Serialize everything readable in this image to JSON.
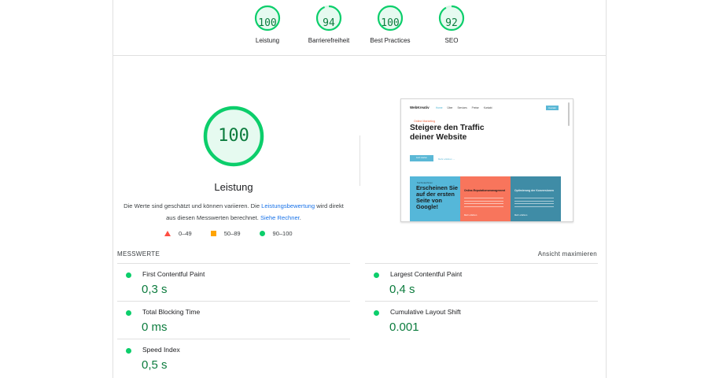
{
  "category_scores": [
    {
      "score": "100",
      "label": "Leistung"
    },
    {
      "score": "94",
      "label": "Barrierefreiheit"
    },
    {
      "score": "100",
      "label": "Best Practices"
    },
    {
      "score": "92",
      "label": "SEO"
    }
  ],
  "performance": {
    "score": "100",
    "title": "Leistung",
    "desc_part1": "Die Werte sind geschätzt und können variieren. Die ",
    "desc_link1": "Leistungsbewertung",
    "desc_part2": " wird direkt aus diesen Messwerten berechnet. ",
    "desc_link2": "Siehe Rechner",
    "desc_part3": "."
  },
  "legend": [
    {
      "shape": "triangle",
      "range": "0–49",
      "color": "#ff4e42"
    },
    {
      "shape": "square",
      "range": "50–89",
      "color": "#ffa400"
    },
    {
      "shape": "circle",
      "range": "90–100",
      "color": "#0cce6b"
    }
  ],
  "screenshot": {
    "brand": "WebKreativ",
    "nav": [
      "Home",
      "Über",
      "Services",
      "Preise",
      "Kontakt"
    ],
    "nav_button": "Kontakt",
    "kicker": "Online Marketing",
    "headline": "Steigere den Traffic deiner Website",
    "cta": "Jetzt starten",
    "link": "Mehr erfahren →",
    "card1_kicker": "Suchmaschinen",
    "card1_title": "Erscheinen Sie auf der ersten Seite von Google!",
    "card2_title": "Online-Reputationsmanagement",
    "card3_title": "Optimierung der Konversionen",
    "more": "Mehr erfahren"
  },
  "metrics": {
    "header": "MESSWERTE",
    "expand": "Ansicht maximieren",
    "items": [
      {
        "name": "First Contentful Paint",
        "value": "0,3 s"
      },
      {
        "name": "Largest Contentful Paint",
        "value": "0,4 s"
      },
      {
        "name": "Total Blocking Time",
        "value": "0 ms"
      },
      {
        "name": "Cumulative Layout Shift",
        "value": "0.001"
      },
      {
        "name": "Speed Index",
        "value": "0,5 s"
      }
    ]
  },
  "colors": {
    "pass": "#0cce6b",
    "pass_text": "#0c7c3e",
    "link": "#1a73e8"
  }
}
